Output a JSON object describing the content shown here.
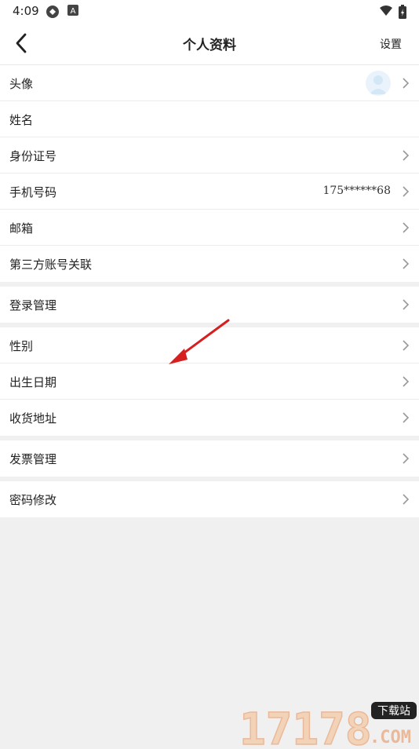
{
  "status_bar": {
    "time": "4:09",
    "icons": [
      "sync-icon",
      "a-badge-icon",
      "wifi-icon",
      "battery-charging-icon"
    ]
  },
  "header": {
    "back_icon": "chevron-left-icon",
    "title": "个人资料",
    "settings_label": "设置"
  },
  "groups": [
    {
      "rows": [
        {
          "label": "头像",
          "value": "",
          "has_avatar": true
        },
        {
          "label": "姓名",
          "value": "",
          "has_chevron": false
        },
        {
          "label": "身份证号",
          "value": ""
        },
        {
          "label": "手机号码",
          "value": "175******68"
        },
        {
          "label": "邮箱",
          "value": ""
        },
        {
          "label": "第三方账号关联",
          "value": ""
        }
      ]
    },
    {
      "rows": [
        {
          "label": "登录管理",
          "value": ""
        }
      ]
    },
    {
      "rows": [
        {
          "label": "性别",
          "value": ""
        },
        {
          "label": "出生日期",
          "value": ""
        },
        {
          "label": "收货地址",
          "value": ""
        }
      ]
    },
    {
      "rows": [
        {
          "label": "发票管理",
          "value": ""
        }
      ]
    },
    {
      "rows": [
        {
          "label": "密码修改",
          "value": ""
        }
      ]
    }
  ],
  "colors": {
    "accent_arrow": "#d61f1f",
    "background": "#f0f0f0",
    "row_background": "#ffffff"
  },
  "watermark": {
    "text": "17178",
    "badge": "下载站",
    "suffix": ".COM"
  }
}
